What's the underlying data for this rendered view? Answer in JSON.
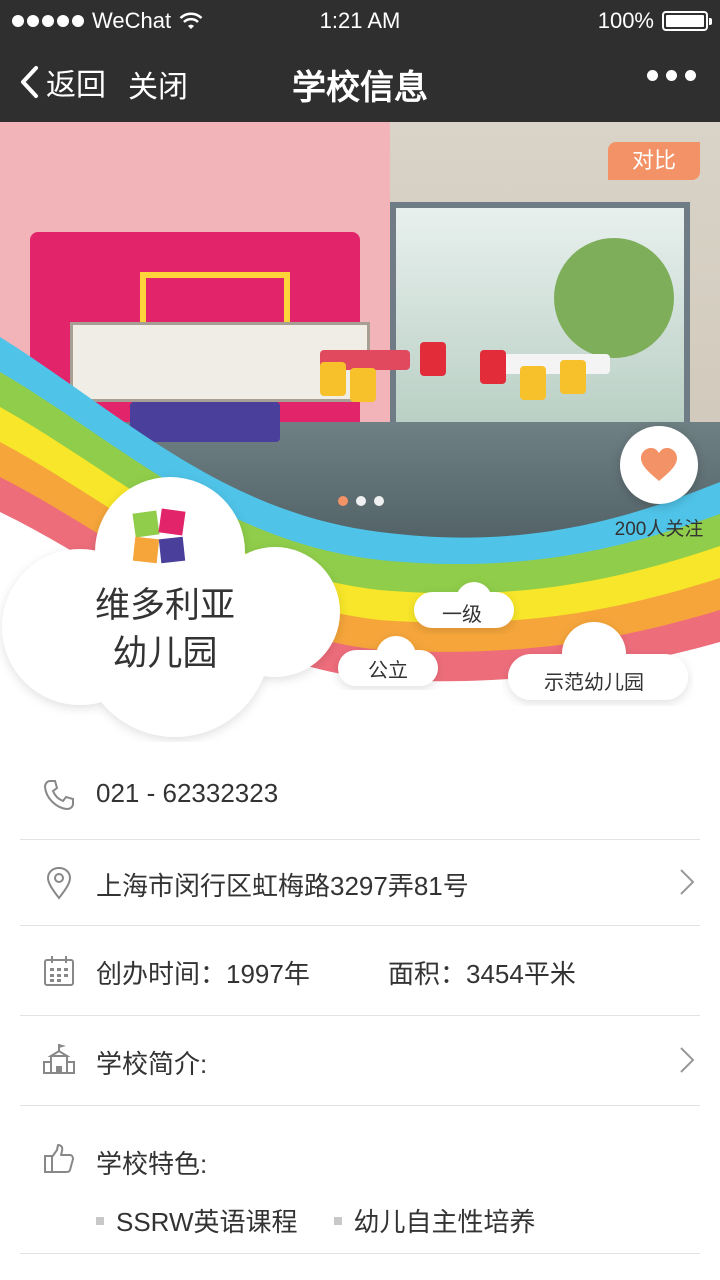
{
  "status_bar": {
    "carrier": "WeChat",
    "time": "1:21 AM",
    "battery": "100%",
    "battery_level": 1.0
  },
  "nav": {
    "back_label": "返回",
    "close_label": "关闭",
    "title": "学校信息"
  },
  "hero": {
    "compare_label": "对比",
    "follow_count": "200人关注",
    "carousel_total": 3,
    "carousel_active": 1
  },
  "school": {
    "name_line1": "维多利亚",
    "name_line2": "幼儿园",
    "tags": [
      "一级",
      "公立",
      "示范幼儿园"
    ]
  },
  "info": {
    "phone": "021 - 62332323",
    "address": "上海市闵行区虹梅路3297弄81号",
    "founded": "创办时间：1997年",
    "area": "面积：3454平米",
    "intro_label": "学校简介:",
    "features_label": "学校特色:",
    "features": [
      "SSRW英语课程",
      "幼儿自主性培养"
    ]
  },
  "colors": {
    "accent": "#f39266",
    "nav_bg": "#2f2f2f",
    "rainbow": [
      "#4fc3e8",
      "#8fcd4a",
      "#f7e629",
      "#f5a53a",
      "#ee6d7b"
    ]
  },
  "icons": {
    "phone": "phone-icon",
    "address": "location-pin-icon",
    "founded": "calendar-icon",
    "intro": "school-building-icon",
    "features": "thumbs-up-icon",
    "follow": "heart-icon"
  }
}
